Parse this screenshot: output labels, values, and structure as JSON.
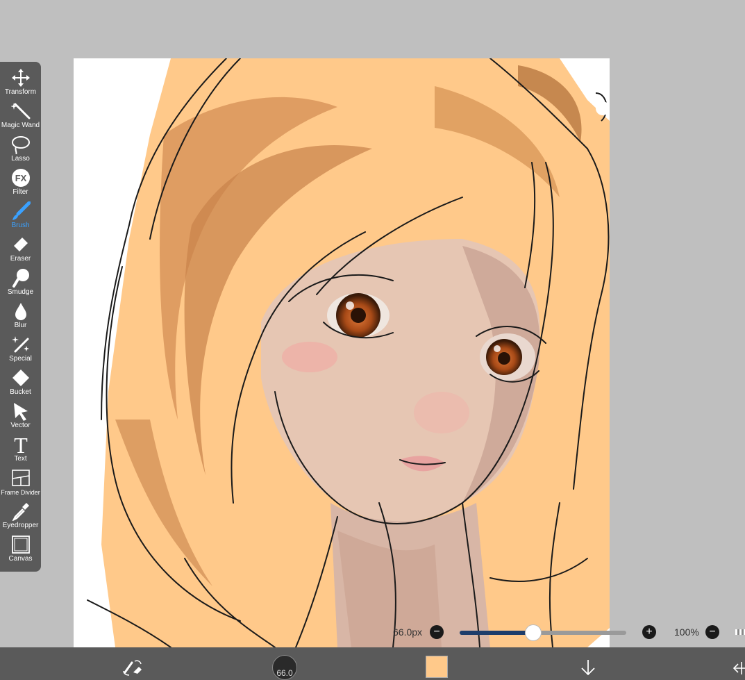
{
  "toolbar": {
    "tools": [
      {
        "label": "Transform",
        "icon": "transform-icon"
      },
      {
        "label": "Magic Wand",
        "icon": "magic-wand-icon"
      },
      {
        "label": "Lasso",
        "icon": "lasso-icon"
      },
      {
        "label": "Filter",
        "icon": "fx-icon",
        "glyph": "FX"
      },
      {
        "label": "Brush",
        "icon": "brush-icon",
        "active": true
      },
      {
        "label": "Eraser",
        "icon": "eraser-icon"
      },
      {
        "label": "Smudge",
        "icon": "smudge-icon"
      },
      {
        "label": "Blur",
        "icon": "blur-drop-icon"
      },
      {
        "label": "Special",
        "icon": "special-sparkle-icon"
      },
      {
        "label": "Bucket",
        "icon": "bucket-icon"
      },
      {
        "label": "Vector",
        "icon": "vector-arrow-icon"
      },
      {
        "label": "Text",
        "icon": "text-icon",
        "glyph": "T"
      },
      {
        "label": "Frame Divider",
        "icon": "frame-divider-icon"
      },
      {
        "label": "Eyedropper",
        "icon": "eyedropper-icon"
      },
      {
        "label": "Canvas",
        "icon": "canvas-icon"
      }
    ],
    "active_color": "#3aa1ff"
  },
  "brush": {
    "size_label": "66.0px",
    "size_fraction": 0.44,
    "badge": "66.0"
  },
  "zoom": {
    "label": "100%"
  },
  "colors": {
    "current": "#ffc98a",
    "fill_track": "#1d3d6b",
    "panel": "#5a5a5a",
    "background": "#bfbfbf"
  }
}
